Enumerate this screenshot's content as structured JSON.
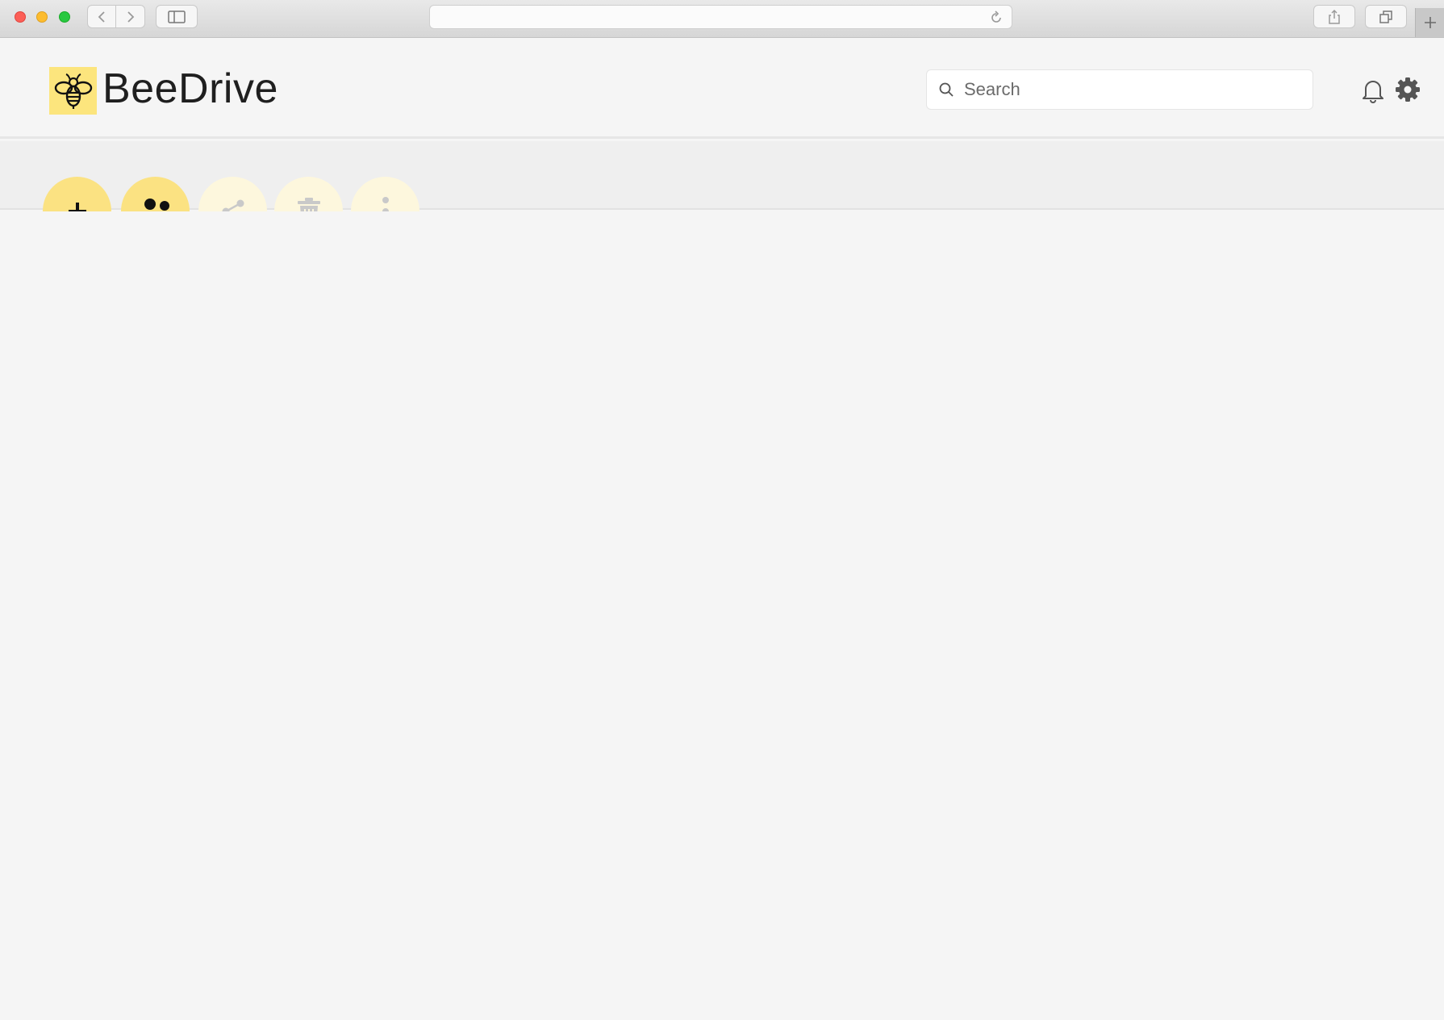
{
  "browser": {
    "address_value": ""
  },
  "app": {
    "brand": "BeeDrive",
    "accent_color": "#fbe282",
    "search": {
      "placeholder": "Search",
      "value": ""
    }
  },
  "toolbar": {
    "actions": [
      {
        "name": "add",
        "icon": "plus-icon",
        "enabled": true
      },
      {
        "name": "people",
        "icon": "users-icon",
        "enabled": true
      },
      {
        "name": "share",
        "icon": "share-icon",
        "enabled": false
      },
      {
        "name": "delete",
        "icon": "trash-icon",
        "enabled": false
      },
      {
        "name": "more",
        "icon": "more-vertical-icon",
        "enabled": false
      }
    ]
  }
}
